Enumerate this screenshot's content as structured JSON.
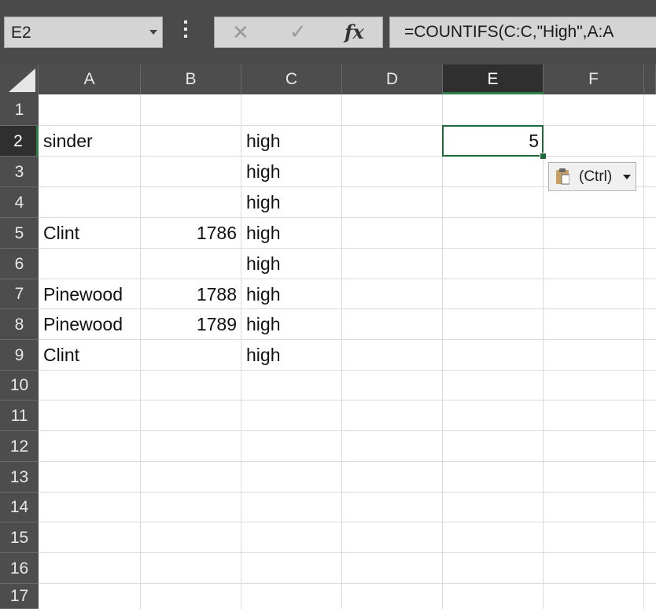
{
  "name_box": {
    "value": "E2"
  },
  "formula_bar": {
    "cancel_icon": "cancel-icon",
    "enter_icon": "enter-icon",
    "fx_label": "fx",
    "formula": "=COUNTIFS(C:C,\"High\",A:A"
  },
  "columns": [
    "A",
    "B",
    "C",
    "D",
    "E",
    "F"
  ],
  "active_column": "E",
  "rows": [
    "1",
    "2",
    "3",
    "4",
    "5",
    "6",
    "7",
    "8",
    "9",
    "10",
    "11",
    "12",
    "13",
    "14",
    "15",
    "16",
    "17"
  ],
  "active_row": "2",
  "cells": {
    "A2": "sinder",
    "C2": "high",
    "E2": "5",
    "C3": "high",
    "C4": "high",
    "A5": "Clint",
    "B5": "1786",
    "C5": "high",
    "C6": "high",
    "A7": "Pinewood",
    "B7": "1788",
    "C7": "high",
    "A8": "Pinewood",
    "B8": "1789",
    "C8": "high",
    "A9": "Clint",
    "C9": "high"
  },
  "paste_options": {
    "label": "(Ctrl)",
    "icon": "clipboard-icon"
  },
  "colors": {
    "selection": "#1e6b38",
    "header_bg": "#4d4d4d",
    "active_header_bg": "#2f2f2f"
  }
}
